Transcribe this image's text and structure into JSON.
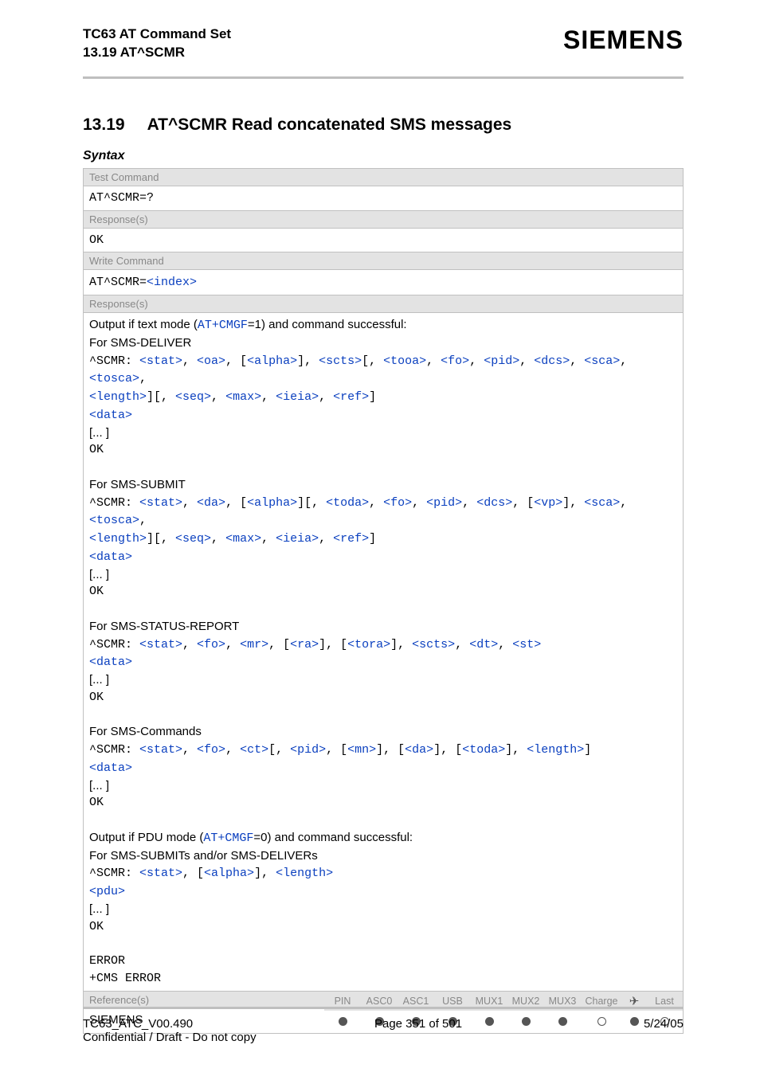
{
  "header": {
    "title1": "TC63 AT Command Set",
    "title2": "13.19 AT^SCMR",
    "brand": "SIEMENS"
  },
  "section": {
    "number": "13.19",
    "title": "AT^SCMR   Read concatenated SMS messages",
    "syntax_label": "Syntax"
  },
  "test_block": {
    "label": "Test Command",
    "cmd": "AT^SCMR=?",
    "resp_label": "Response(s)",
    "resp": "OK"
  },
  "write_block": {
    "label": "Write Command",
    "cmd_prefix": "AT^SCMR=",
    "cmd_param": "<index>",
    "resp_label": "Response(s)",
    "intro_text_a": "Output if text mode (",
    "intro_link": "AT+CMGF",
    "intro_text_b": "=1) and command successful:",
    "deliver_label": "For SMS-DELIVER",
    "line_prefix": "^SCMR: ",
    "deliver_params": [
      "<stat>",
      "<oa>",
      "<alpha>",
      "<scts>",
      "<tooa>",
      "<fo>",
      "<pid>",
      "<dcs>",
      "<sca>",
      "<tosca>",
      "<length>",
      "<seq>",
      "<max>",
      "<ieia>",
      "<ref>"
    ],
    "data_token": "<data>",
    "ellipsis": "[... ]",
    "ok": "OK",
    "submit_label": "For SMS-SUBMIT",
    "submit_params": [
      "<stat>",
      "<da>",
      "<alpha>",
      "<toda>",
      "<fo>",
      "<pid>",
      "<dcs>",
      "<vp>",
      "<sca>",
      "<tosca>",
      "<length>",
      "<seq>",
      "<max>",
      "<ieia>",
      "<ref>"
    ],
    "status_label": "For SMS-STATUS-REPORT",
    "status_params": [
      "<stat>",
      "<fo>",
      "<mr>",
      "<ra>",
      "<tora>",
      "<scts>",
      "<dt>",
      "<st>"
    ],
    "commands_label": "For SMS-Commands",
    "commands_params": [
      "<stat>",
      "<fo>",
      "<ct>",
      "<pid>",
      "<mn>",
      "<da>",
      "<toda>",
      "<length>"
    ],
    "pdu_intro_a": "Output if PDU mode (",
    "pdu_intro_b": "=0) and command successful:",
    "pdu_label": "For SMS-SUBMITs and/or SMS-DELIVERs",
    "pdu_params": [
      "<stat>",
      "<alpha>",
      "<length>"
    ],
    "pdu_token": "<pdu>",
    "error": "ERROR",
    "cms_error": "+CMS ERROR"
  },
  "ref": {
    "label": "Reference(s)",
    "value": "SIEMENS",
    "cols": [
      "PIN",
      "ASC0",
      "ASC1",
      "USB",
      "MUX1",
      "MUX2",
      "MUX3",
      "Charge",
      "",
      "Last"
    ],
    "dots": [
      "f",
      "f",
      "f",
      "f",
      "f",
      "f",
      "f",
      "o",
      "f",
      "o"
    ]
  },
  "footer": {
    "left": "TC63_ATC_V00.490",
    "center": "Page 351 of 501",
    "right": "5/24/05",
    "conf": "Confidential / Draft - Do not copy"
  }
}
